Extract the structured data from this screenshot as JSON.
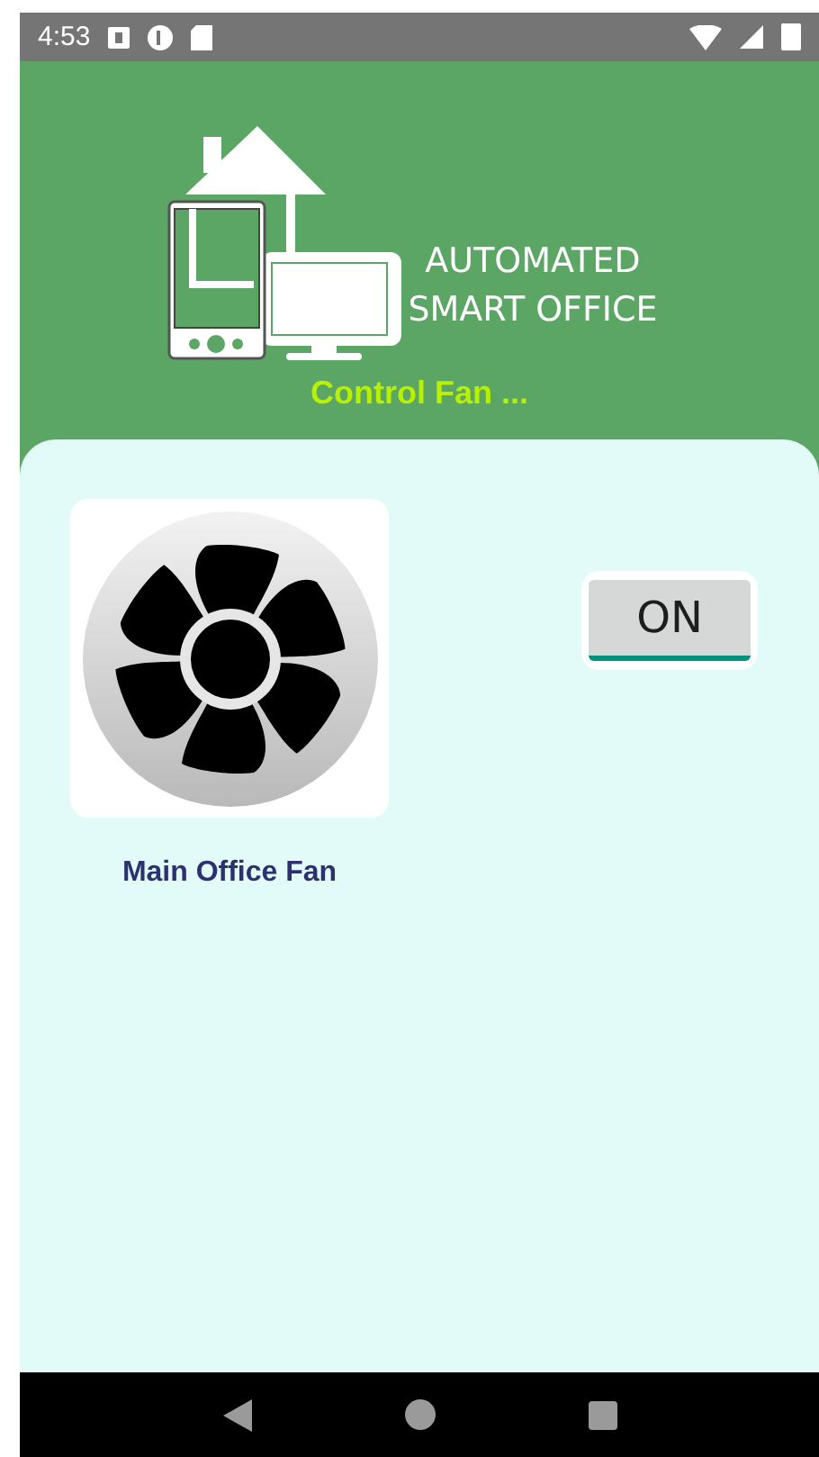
{
  "status_bar": {
    "time": "4:53"
  },
  "header": {
    "logo_lines": [
      "AUTOMATED",
      "SMART OFFICE"
    ],
    "subtitle": "Control Fan ..."
  },
  "devices": [
    {
      "name": "Main Office Fan",
      "toggle": {
        "label": "ON",
        "on": true
      }
    }
  ]
}
